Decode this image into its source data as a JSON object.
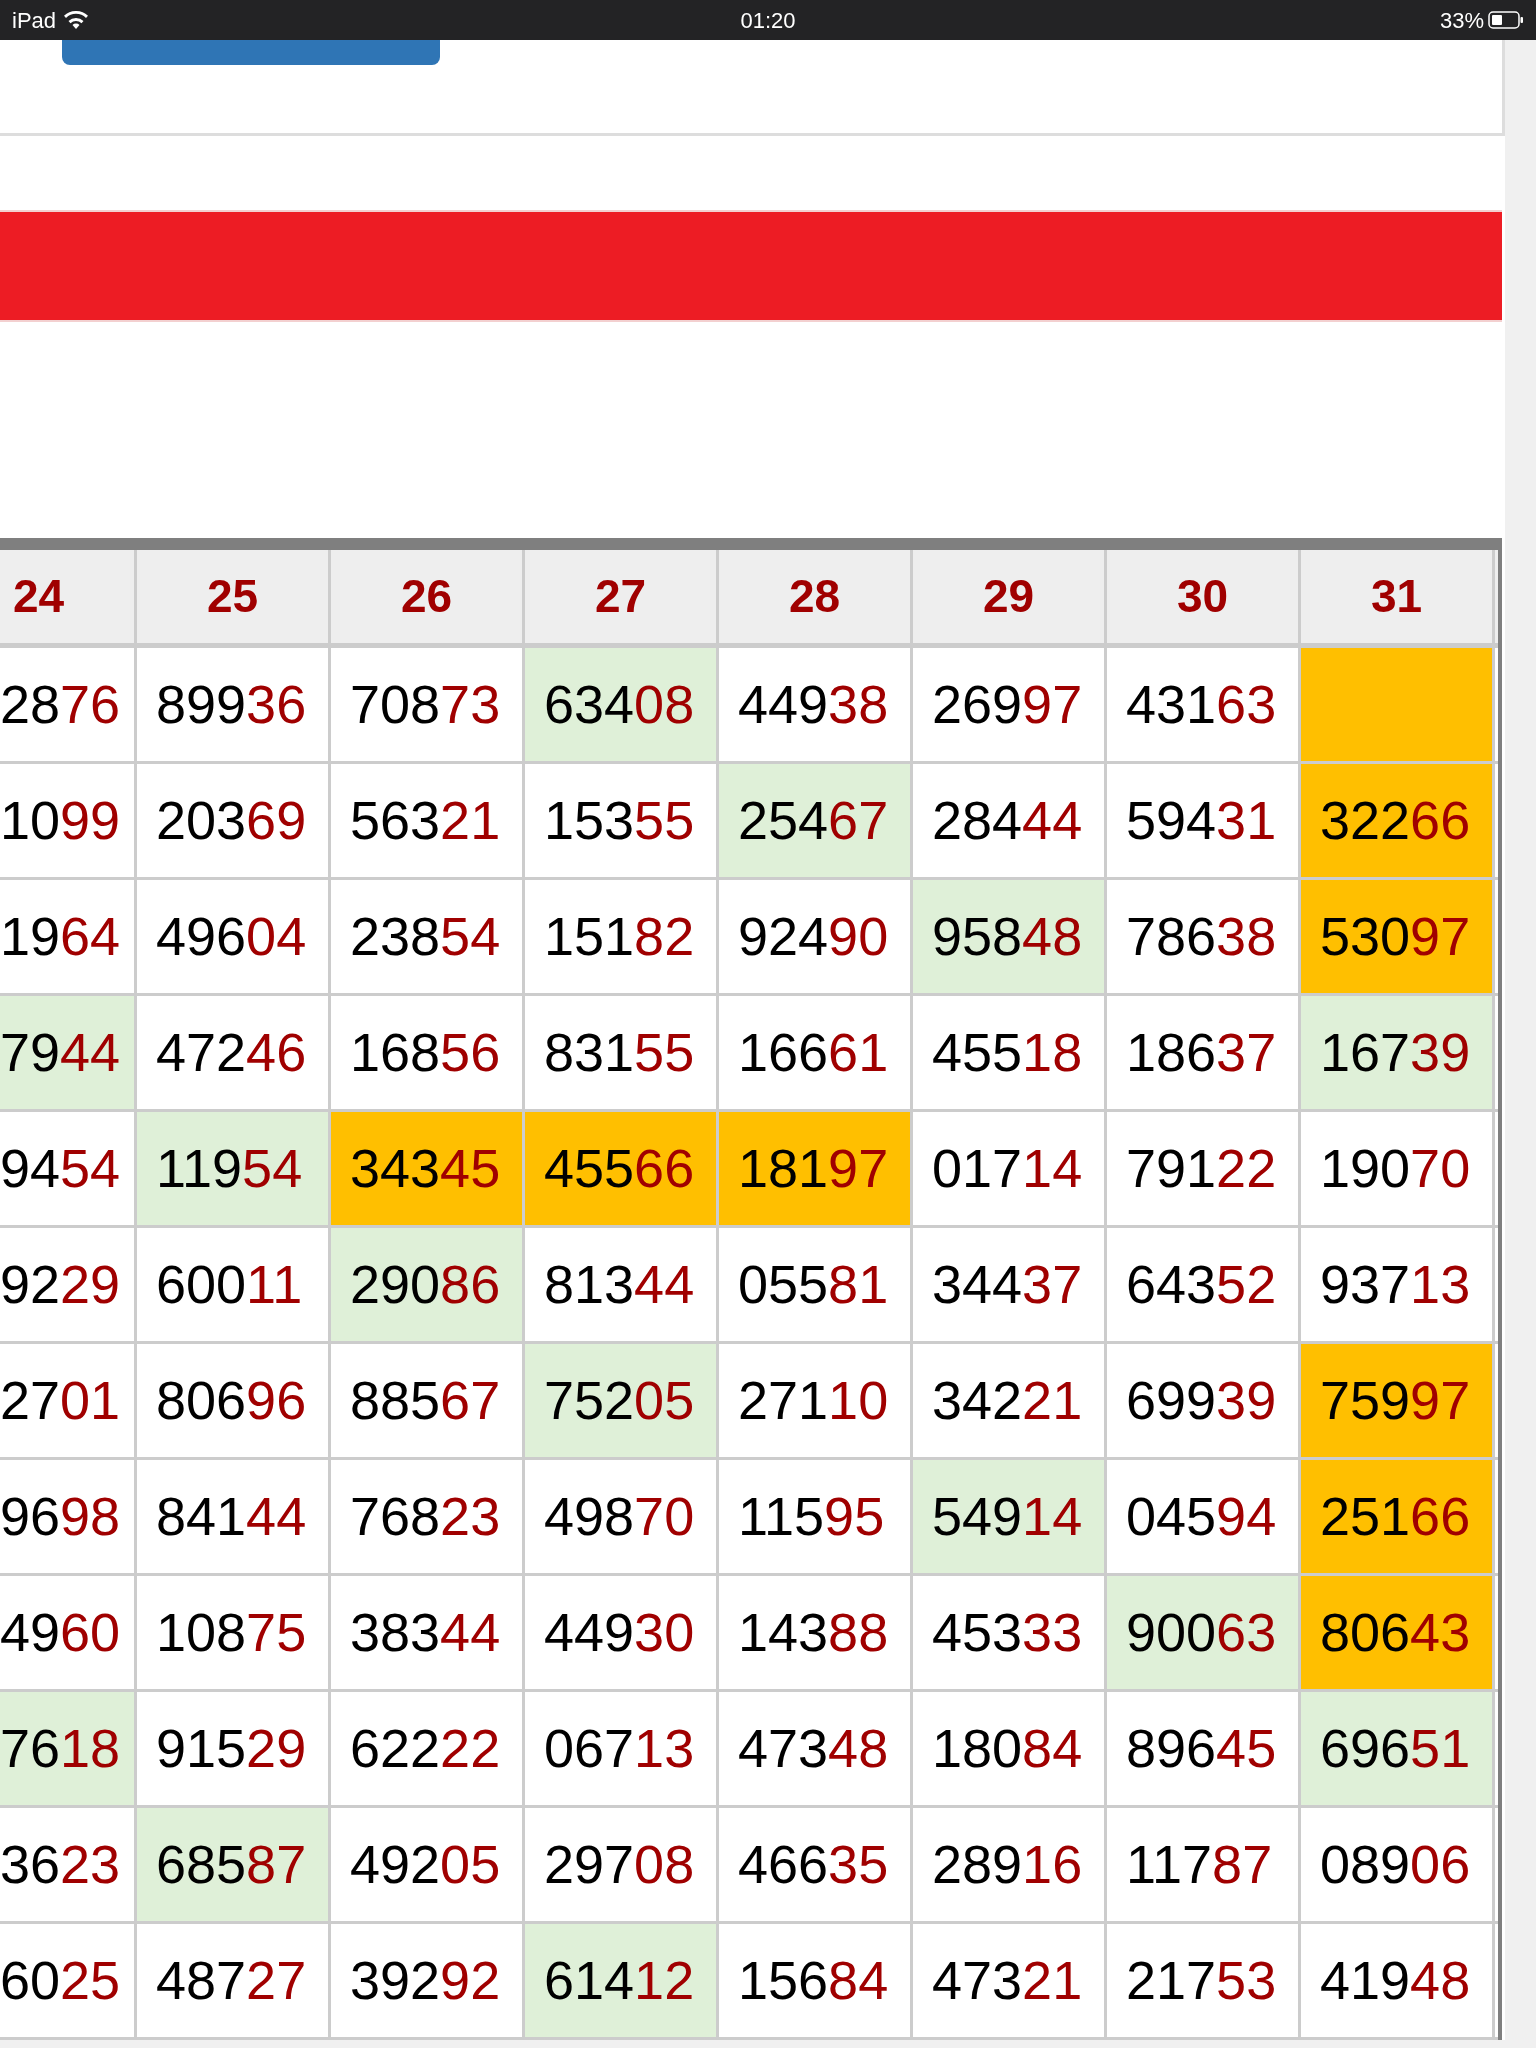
{
  "status_bar": {
    "device": "iPad",
    "time": "01:20",
    "battery": "33%"
  },
  "table": {
    "columns": [
      "24",
      "25",
      "26",
      "27",
      "28",
      "29",
      "30",
      "31"
    ],
    "rows": [
      [
        {
          "black": "28",
          "red": "76",
          "color": "#ffffff"
        },
        {
          "black": "899",
          "red": "36",
          "color": "#ffffff"
        },
        {
          "black": "708",
          "red": "73",
          "color": "#ffffff"
        },
        {
          "black": "634",
          "red": "08",
          "color": "#dff0d8"
        },
        {
          "black": "449",
          "red": "38",
          "color": "#ffffff"
        },
        {
          "black": "269",
          "red": "97",
          "color": "#ffffff"
        },
        {
          "black": "431",
          "red": "63",
          "color": "#ffffff"
        },
        {
          "color": "#ffbf00"
        }
      ],
      [
        {
          "black": "10",
          "red": "99",
          "color": "#ffffff"
        },
        {
          "black": "203",
          "red": "69",
          "color": "#ffffff"
        },
        {
          "black": "563",
          "red": "21",
          "color": "#ffffff"
        },
        {
          "black": "153",
          "red": "55",
          "color": "#ffffff"
        },
        {
          "black": "254",
          "red": "67",
          "color": "#dff0d8"
        },
        {
          "black": "284",
          "red": "44",
          "color": "#ffffff"
        },
        {
          "black": "594",
          "red": "31",
          "color": "#ffffff"
        },
        {
          "black": "322",
          "red": "66",
          "color": "#ffbf00"
        }
      ],
      [
        {
          "black": "19",
          "red": "64",
          "color": "#ffffff"
        },
        {
          "black": "496",
          "red": "04",
          "color": "#ffffff"
        },
        {
          "black": "238",
          "red": "54",
          "color": "#ffffff"
        },
        {
          "black": "151",
          "red": "82",
          "color": "#ffffff"
        },
        {
          "black": "924",
          "red": "90",
          "color": "#ffffff"
        },
        {
          "black": "958",
          "red": "48",
          "color": "#dff0d8"
        },
        {
          "black": "786",
          "red": "38",
          "color": "#ffffff"
        },
        {
          "black": "530",
          "red": "97",
          "color": "#ffbf00"
        }
      ],
      [
        {
          "black": "79",
          "red": "44",
          "color": "#dff0d8"
        },
        {
          "black": "472",
          "red": "46",
          "color": "#ffffff"
        },
        {
          "black": "168",
          "red": "56",
          "color": "#ffffff"
        },
        {
          "black": "831",
          "red": "55",
          "color": "#ffffff"
        },
        {
          "black": "166",
          "red": "61",
          "color": "#ffffff"
        },
        {
          "black": "455",
          "red": "18",
          "color": "#ffffff"
        },
        {
          "black": "186",
          "red": "37",
          "color": "#ffffff"
        },
        {
          "black": "167",
          "red": "39",
          "color": "#dff0d8"
        }
      ],
      [
        {
          "black": "94",
          "red": "54",
          "color": "#ffffff"
        },
        {
          "black": "119",
          "red": "54",
          "color": "#dff0d8"
        },
        {
          "black": "343",
          "red": "45",
          "color": "#ffbf00"
        },
        {
          "black": "455",
          "red": "66",
          "color": "#ffbf00"
        },
        {
          "black": "181",
          "red": "97",
          "color": "#ffbf00"
        },
        {
          "black": "017",
          "red": "14",
          "color": "#ffffff"
        },
        {
          "black": "791",
          "red": "22",
          "color": "#ffffff"
        },
        {
          "black": "190",
          "red": "70",
          "color": "#ffffff"
        }
      ],
      [
        {
          "black": "92",
          "red": "29",
          "color": "#ffffff"
        },
        {
          "black": "600",
          "red": "11",
          "color": "#ffffff"
        },
        {
          "black": "290",
          "red": "86",
          "color": "#dff0d8"
        },
        {
          "black": "813",
          "red": "44",
          "color": "#ffffff"
        },
        {
          "black": "055",
          "red": "81",
          "color": "#ffffff"
        },
        {
          "black": "344",
          "red": "37",
          "color": "#ffffff"
        },
        {
          "black": "643",
          "red": "52",
          "color": "#ffffff"
        },
        {
          "black": "937",
          "red": "13",
          "color": "#ffffff"
        }
      ],
      [
        {
          "black": "27",
          "red": "01",
          "color": "#ffffff"
        },
        {
          "black": "806",
          "red": "96",
          "color": "#ffffff"
        },
        {
          "black": "885",
          "red": "67",
          "color": "#ffffff"
        },
        {
          "black": "752",
          "red": "05",
          "color": "#dff0d8"
        },
        {
          "black": "271",
          "red": "10",
          "color": "#ffffff"
        },
        {
          "black": "342",
          "red": "21",
          "color": "#ffffff"
        },
        {
          "black": "699",
          "red": "39",
          "color": "#ffffff"
        },
        {
          "black": "759",
          "red": "97",
          "color": "#ffbf00"
        }
      ],
      [
        {
          "black": "96",
          "red": "98",
          "color": "#ffffff"
        },
        {
          "black": "841",
          "red": "44",
          "color": "#ffffff"
        },
        {
          "black": "768",
          "red": "23",
          "color": "#ffffff"
        },
        {
          "black": "498",
          "red": "70",
          "color": "#ffffff"
        },
        {
          "black": "115",
          "red": "95",
          "color": "#ffffff"
        },
        {
          "black": "549",
          "red": "14",
          "color": "#dff0d8"
        },
        {
          "black": "045",
          "red": "94",
          "color": "#ffffff"
        },
        {
          "black": "251",
          "red": "66",
          "color": "#ffbf00"
        }
      ],
      [
        {
          "black": "49",
          "red": "60",
          "color": "#ffffff"
        },
        {
          "black": "108",
          "red": "75",
          "color": "#ffffff"
        },
        {
          "black": "383",
          "red": "44",
          "color": "#ffffff"
        },
        {
          "black": "449",
          "red": "30",
          "color": "#ffffff"
        },
        {
          "black": "143",
          "red": "88",
          "color": "#ffffff"
        },
        {
          "black": "453",
          "red": "33",
          "color": "#ffffff"
        },
        {
          "black": "900",
          "red": "63",
          "color": "#dff0d8"
        },
        {
          "black": "806",
          "red": "43",
          "color": "#ffbf00"
        }
      ],
      [
        {
          "black": "76",
          "red": "18",
          "color": "#dff0d8"
        },
        {
          "black": "915",
          "red": "29",
          "color": "#ffffff"
        },
        {
          "black": "622",
          "red": "22",
          "color": "#ffffff"
        },
        {
          "black": "067",
          "red": "13",
          "color": "#ffffff"
        },
        {
          "black": "473",
          "red": "48",
          "color": "#ffffff"
        },
        {
          "black": "180",
          "red": "84",
          "color": "#ffffff"
        },
        {
          "black": "896",
          "red": "45",
          "color": "#ffffff"
        },
        {
          "black": "696",
          "red": "51",
          "color": "#dff0d8"
        }
      ],
      [
        {
          "black": "36",
          "red": "23",
          "color": "#ffffff"
        },
        {
          "black": "685",
          "red": "87",
          "color": "#dff0d8"
        },
        {
          "black": "492",
          "red": "05",
          "color": "#ffffff"
        },
        {
          "black": "297",
          "red": "08",
          "color": "#ffffff"
        },
        {
          "black": "466",
          "red": "35",
          "color": "#ffffff"
        },
        {
          "black": "289",
          "red": "16",
          "color": "#ffffff"
        },
        {
          "black": "117",
          "red": "87",
          "color": "#ffffff"
        },
        {
          "black": "089",
          "red": "06",
          "color": "#ffffff"
        }
      ],
      [
        {
          "black": "60",
          "red": "25",
          "color": "#ffffff"
        },
        {
          "black": "487",
          "red": "27",
          "color": "#ffffff"
        },
        {
          "black": "392",
          "red": "92",
          "color": "#ffffff"
        },
        {
          "black": "614",
          "red": "12",
          "color": "#dff0d8"
        },
        {
          "black": "156",
          "red": "84",
          "color": "#ffffff"
        },
        {
          "black": "473",
          "red": "21",
          "color": "#ffffff"
        },
        {
          "black": "217",
          "red": "53",
          "color": "#ffffff"
        },
        {
          "black": "419",
          "red": "48",
          "color": "#ffffff"
        }
      ]
    ]
  }
}
